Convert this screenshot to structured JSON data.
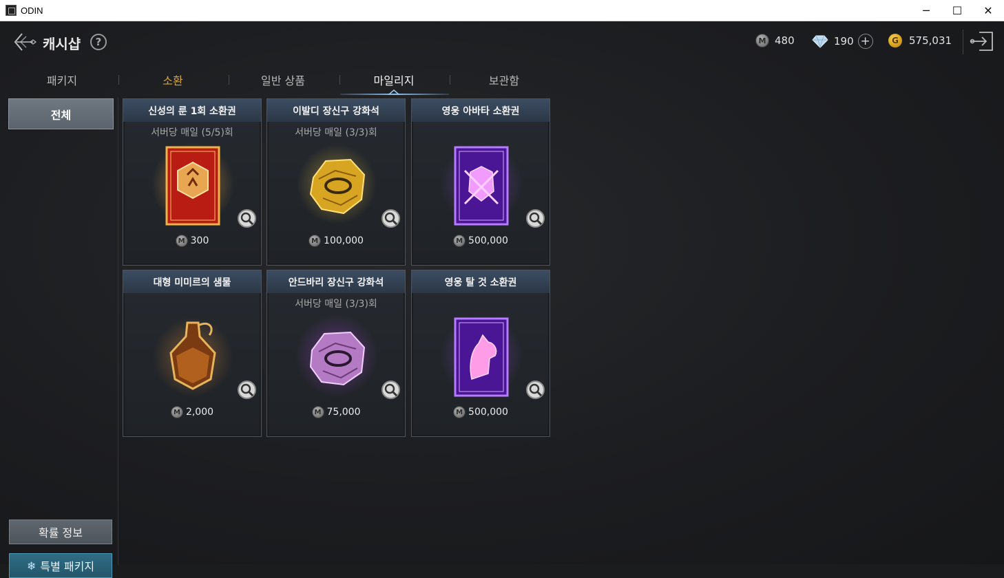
{
  "window": {
    "title": "ODIN",
    "minimize": "─",
    "maximize": "☐",
    "close": "✕"
  },
  "header": {
    "title": "캐시샵",
    "help": "?",
    "currencies": {
      "mileage": {
        "symbol": "M",
        "value": "480"
      },
      "diamond": {
        "value": "190",
        "plus": "+"
      },
      "gold": {
        "symbol": "G",
        "value": "575,031"
      }
    }
  },
  "tabs": [
    {
      "label": "패키지"
    },
    {
      "label": "소환"
    },
    {
      "label": "일반 상품"
    },
    {
      "label": "마일리지"
    },
    {
      "label": "보관함"
    }
  ],
  "sidebar": {
    "category_all": "전체",
    "probability_button": "확률 정보",
    "special_package_button": "특별 패키지"
  },
  "items": [
    {
      "name": "신성의 룬 1회 소환권",
      "limit": "서버당 매일 (5/5)회",
      "price": "300",
      "icon": "rune-summon-card-icon"
    },
    {
      "name": "이발디 장신구 강화석",
      "limit": "서버당 매일 (3/3)회",
      "price": "100,000",
      "icon": "gold-enhance-stone-icon"
    },
    {
      "name": "영웅 아바타 소환권",
      "limit": "",
      "price": "500,000",
      "icon": "avatar-summon-card-icon"
    },
    {
      "name": "대형 미미르의 샘물",
      "limit": "",
      "price": "2,000",
      "icon": "mimir-potion-icon"
    },
    {
      "name": "안드바리 장신구 강화석",
      "limit": "서버당 매일 (3/3)회",
      "price": "75,000",
      "icon": "purple-enhance-stone-icon"
    },
    {
      "name": "영웅 탈 것 소환권",
      "limit": "",
      "price": "500,000",
      "icon": "mount-summon-card-icon"
    }
  ],
  "colors": {
    "accent_gold": "#d7a53a",
    "card_header": "#3c4d62",
    "active_tab_line": "#8fbfe8"
  }
}
